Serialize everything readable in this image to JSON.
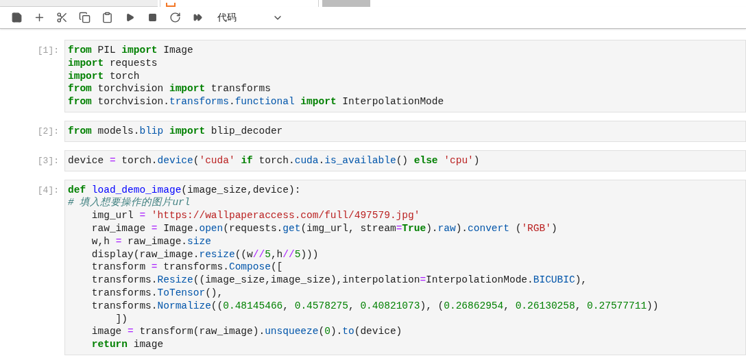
{
  "tabs": [
    {
      "selected": false
    },
    {
      "selected": true
    }
  ],
  "toolbar": {
    "cell_type": "代码"
  },
  "cells": [
    {
      "prompt": "[1]:",
      "lines": [
        [
          {
            "kind": "kw",
            "text": "from"
          },
          {
            "kind": "plain",
            "text": " PIL "
          },
          {
            "kind": "kw",
            "text": "import"
          },
          {
            "kind": "plain",
            "text": " Image"
          }
        ],
        [
          {
            "kind": "kw",
            "text": "import"
          },
          {
            "kind": "plain",
            "text": " requests"
          }
        ],
        [
          {
            "kind": "kw",
            "text": "import"
          },
          {
            "kind": "plain",
            "text": " torch"
          }
        ],
        [
          {
            "kind": "kw",
            "text": "from"
          },
          {
            "kind": "plain",
            "text": " torchvision "
          },
          {
            "kind": "kw",
            "text": "import"
          },
          {
            "kind": "plain",
            "text": " transforms"
          }
        ],
        [
          {
            "kind": "kw",
            "text": "from"
          },
          {
            "kind": "plain",
            "text": " torchvision."
          },
          {
            "kind": "attr",
            "text": "transforms"
          },
          {
            "kind": "plain",
            "text": "."
          },
          {
            "kind": "attr",
            "text": "functional"
          },
          {
            "kind": "kw",
            "text": " import"
          },
          {
            "kind": "plain",
            "text": " InterpolationMode"
          }
        ]
      ]
    },
    {
      "prompt": "[2]:",
      "lines": [
        [
          {
            "kind": "kw",
            "text": "from"
          },
          {
            "kind": "plain",
            "text": " models."
          },
          {
            "kind": "attr",
            "text": "blip"
          },
          {
            "kind": "kw",
            "text": " import"
          },
          {
            "kind": "plain",
            "text": " blip_decoder"
          }
        ]
      ]
    },
    {
      "prompt": "[3]:",
      "lines": [
        [
          {
            "kind": "plain",
            "text": "device "
          },
          {
            "kind": "op",
            "text": "="
          },
          {
            "kind": "plain",
            "text": " torch."
          },
          {
            "kind": "attr",
            "text": "device"
          },
          {
            "kind": "plain",
            "text": "("
          },
          {
            "kind": "str",
            "text": "'cuda'"
          },
          {
            "kind": "kw",
            "text": " if"
          },
          {
            "kind": "plain",
            "text": " torch."
          },
          {
            "kind": "attr",
            "text": "cuda"
          },
          {
            "kind": "plain",
            "text": "."
          },
          {
            "kind": "attr",
            "text": "is_available"
          },
          {
            "kind": "plain",
            "text": "() "
          },
          {
            "kind": "kw",
            "text": "else"
          },
          {
            "kind": "str",
            "text": " 'cpu'"
          },
          {
            "kind": "plain",
            "text": ")"
          }
        ]
      ]
    },
    {
      "prompt": "[4]:",
      "lines": [
        [
          {
            "kind": "kw",
            "text": "def"
          },
          {
            "kind": "fn",
            "text": " load_demo_image"
          },
          {
            "kind": "plain",
            "text": "(image_size,device):"
          }
        ],
        [
          {
            "kind": "comment",
            "text": "# 填入想要操作的图片url"
          }
        ],
        [
          {
            "kind": "plain",
            "text": "    img_url "
          },
          {
            "kind": "op",
            "text": "="
          },
          {
            "kind": "str",
            "text": " 'https://wallpaperaccess.com/full/497579.jpg'"
          }
        ],
        [
          {
            "kind": "plain",
            "text": "    raw_image "
          },
          {
            "kind": "op",
            "text": "="
          },
          {
            "kind": "plain",
            "text": " Image."
          },
          {
            "kind": "attr",
            "text": "open"
          },
          {
            "kind": "plain",
            "text": "(requests."
          },
          {
            "kind": "attr",
            "text": "get"
          },
          {
            "kind": "plain",
            "text": "(img_url, stream"
          },
          {
            "kind": "op",
            "text": "="
          },
          {
            "kind": "kw",
            "text": "True"
          },
          {
            "kind": "plain",
            "text": ")."
          },
          {
            "kind": "attr",
            "text": "raw"
          },
          {
            "kind": "plain",
            "text": ")."
          },
          {
            "kind": "attr",
            "text": "convert"
          },
          {
            "kind": "plain",
            "text": " ("
          },
          {
            "kind": "str",
            "text": "'RGB'"
          },
          {
            "kind": "plain",
            "text": ")"
          }
        ],
        [
          {
            "kind": "plain",
            "text": "    w,h "
          },
          {
            "kind": "op",
            "text": "="
          },
          {
            "kind": "plain",
            "text": " raw_image."
          },
          {
            "kind": "attr",
            "text": "size"
          }
        ],
        [
          {
            "kind": "plain",
            "text": "    display(raw_image."
          },
          {
            "kind": "attr",
            "text": "resize"
          },
          {
            "kind": "plain",
            "text": "((w"
          },
          {
            "kind": "op",
            "text": "//"
          },
          {
            "kind": "num",
            "text": "5"
          },
          {
            "kind": "plain",
            "text": ",h"
          },
          {
            "kind": "op",
            "text": "//"
          },
          {
            "kind": "num",
            "text": "5"
          },
          {
            "kind": "plain",
            "text": ")))"
          }
        ],
        [
          {
            "kind": "plain",
            "text": "    transform "
          },
          {
            "kind": "op",
            "text": "="
          },
          {
            "kind": "plain",
            "text": " transforms."
          },
          {
            "kind": "attr",
            "text": "Compose"
          },
          {
            "kind": "plain",
            "text": "(["
          }
        ],
        [
          {
            "kind": "plain",
            "text": "    transforms."
          },
          {
            "kind": "attr",
            "text": "Resize"
          },
          {
            "kind": "plain",
            "text": "((image_size,image_size),interpolation"
          },
          {
            "kind": "op",
            "text": "="
          },
          {
            "kind": "plain",
            "text": "InterpolationMode."
          },
          {
            "kind": "attr",
            "text": "BICUBIC"
          },
          {
            "kind": "plain",
            "text": "),"
          }
        ],
        [
          {
            "kind": "plain",
            "text": "    transforms."
          },
          {
            "kind": "attr",
            "text": "ToTensor"
          },
          {
            "kind": "plain",
            "text": "(),"
          }
        ],
        [
          {
            "kind": "plain",
            "text": "    transforms."
          },
          {
            "kind": "attr",
            "text": "Normalize"
          },
          {
            "kind": "plain",
            "text": "(("
          },
          {
            "kind": "num",
            "text": "0.48145466"
          },
          {
            "kind": "plain",
            "text": ", "
          },
          {
            "kind": "num",
            "text": "0.4578275"
          },
          {
            "kind": "plain",
            "text": ", "
          },
          {
            "kind": "num",
            "text": "0.40821073"
          },
          {
            "kind": "plain",
            "text": "), ("
          },
          {
            "kind": "num",
            "text": "0.26862954"
          },
          {
            "kind": "plain",
            "text": ", "
          },
          {
            "kind": "num",
            "text": "0.26130258"
          },
          {
            "kind": "plain",
            "text": ", "
          },
          {
            "kind": "num",
            "text": "0.27577711"
          },
          {
            "kind": "plain",
            "text": "))"
          }
        ],
        [
          {
            "kind": "plain",
            "text": "        ])"
          }
        ],
        [
          {
            "kind": "plain",
            "text": "    image "
          },
          {
            "kind": "op",
            "text": "="
          },
          {
            "kind": "plain",
            "text": " transform(raw_image)."
          },
          {
            "kind": "attr",
            "text": "unsqueeze"
          },
          {
            "kind": "plain",
            "text": "("
          },
          {
            "kind": "num",
            "text": "0"
          },
          {
            "kind": "plain",
            "text": ")."
          },
          {
            "kind": "attr",
            "text": "to"
          },
          {
            "kind": "plain",
            "text": "(device)"
          }
        ],
        [
          {
            "kind": "kw",
            "text": "    return"
          },
          {
            "kind": "plain",
            "text": " image"
          }
        ]
      ]
    }
  ]
}
